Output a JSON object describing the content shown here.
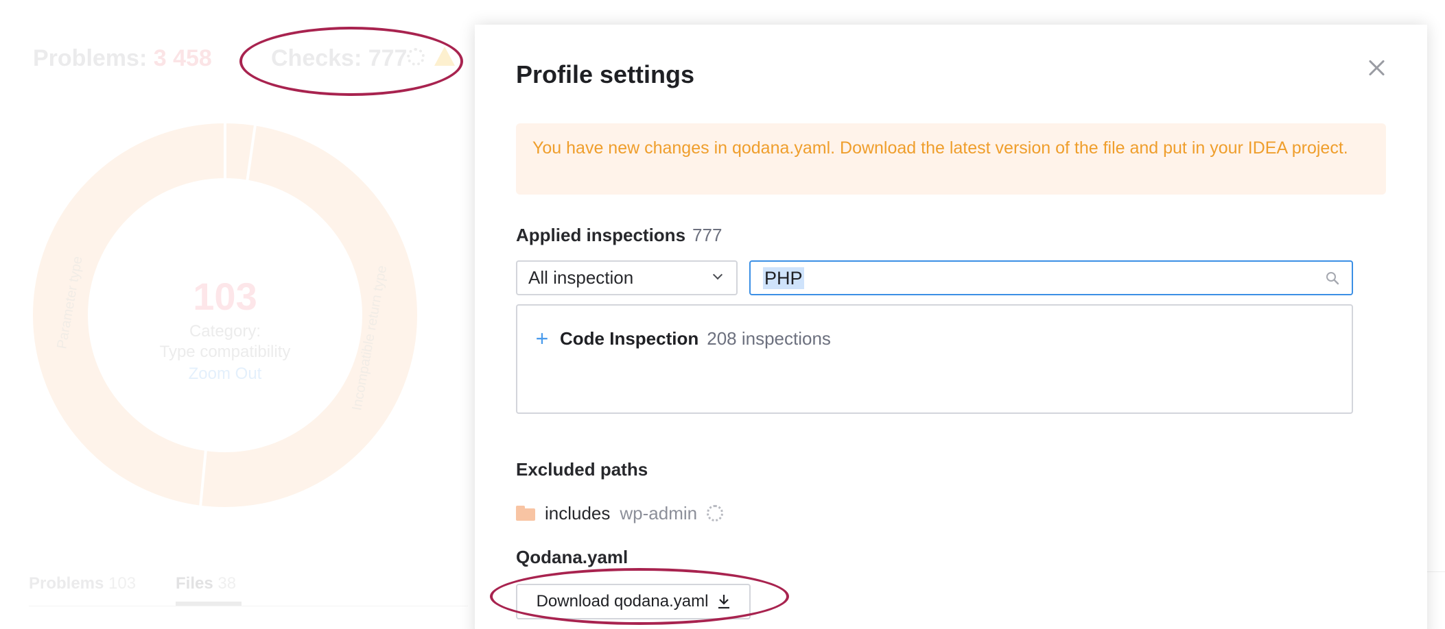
{
  "background": {
    "problems_label": "Problems:",
    "problems_value": "3 458",
    "checks_label": "Checks:",
    "checks_value": "777",
    "donut": {
      "count": "103",
      "category_label": "Category:",
      "category_name": "Type compatibility",
      "zoom_out": "Zoom Out",
      "segment_labels": [
        "Parameter type",
        "Incompatible return type"
      ]
    },
    "tabs": [
      {
        "label": "Problems",
        "count": "103"
      },
      {
        "label": "Files",
        "count": "38"
      }
    ]
  },
  "dialog": {
    "title": "Profile settings",
    "warning": "You have new changes in qodana.yaml. Download the latest version of the file and put in your IDEA project.",
    "applied_label": "Applied inspections",
    "applied_count": "777",
    "filter_select": "All inspection",
    "search_value": "PHP",
    "groups": [
      {
        "name": "Code Inspection",
        "count": "208 inspections"
      }
    ],
    "excluded_label": "Excluded paths",
    "excluded_paths": [
      "includes",
      "wp-admin"
    ],
    "qodana_label": "Qodana.yaml",
    "download_label": "Download qodana.yaml"
  },
  "colors": {
    "accent_blue": "#3b8fe5",
    "warning_text": "#ef9e2c",
    "warning_bg": "#fff3ea",
    "annotation": "#a8234f"
  }
}
